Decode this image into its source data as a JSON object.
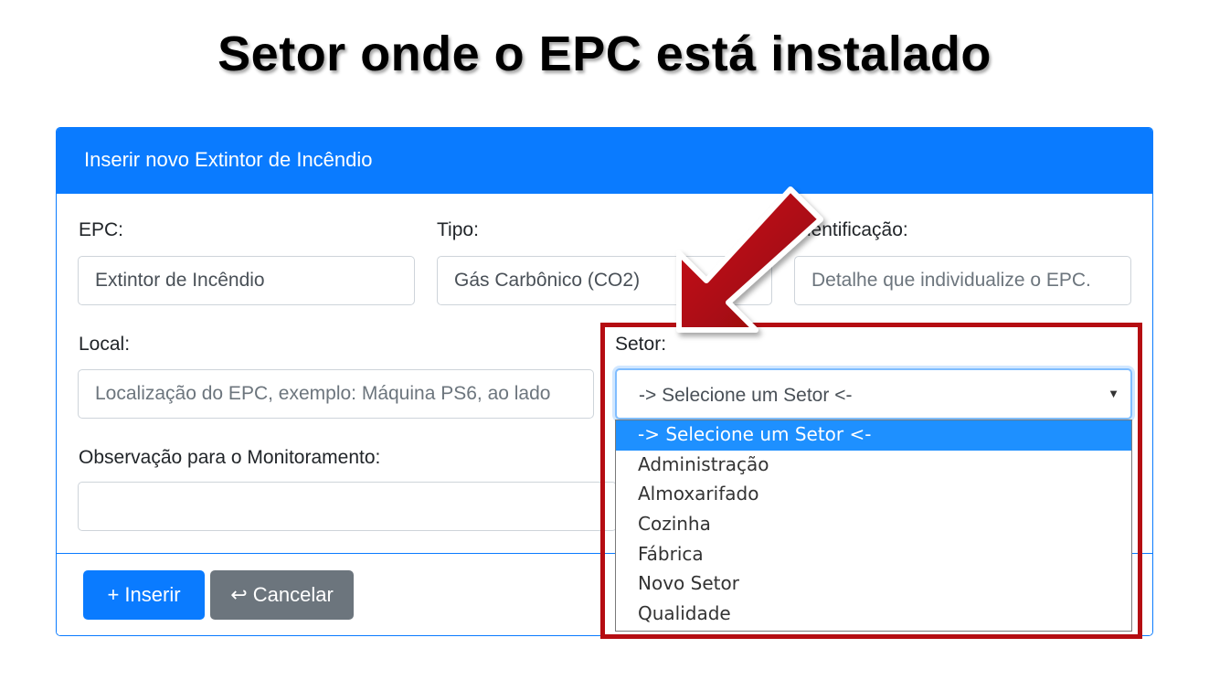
{
  "slide_title": "Setor onde o EPC está instalado",
  "card": {
    "header": "Inserir novo Extintor de Incêndio"
  },
  "form": {
    "epc": {
      "label": "EPC:",
      "value": "Extintor de Incêndio"
    },
    "tipo": {
      "label": "Tipo:",
      "value": "Gás Carbônico (CO2)"
    },
    "identificacao": {
      "label": "Identificação:",
      "placeholder": "Detalhe que individualize o EPC."
    },
    "local": {
      "label": "Local:",
      "placeholder": "Localização do EPC, exemplo: Máquina PS6, ao lado"
    },
    "setor": {
      "label": "Setor:",
      "selected": "-> Selecione um Setor <-",
      "options": [
        "-> Selecione um Setor <-",
        "Administração",
        "Almoxarifado",
        "Cozinha",
        "Fábrica",
        "Novo Setor",
        "Qualidade"
      ]
    },
    "observacao": {
      "label": "Observação para o Monitoramento:",
      "value": ""
    }
  },
  "footer": {
    "insert_label": "+ Inserir",
    "cancel_label": "↩ Cancelar"
  },
  "annotation": {
    "arrow_icon": "red-arrow-icon",
    "color": "#b50d12"
  },
  "colors": {
    "primary": "#0a7bff",
    "secondary": "#6c757d",
    "option_highlight": "#1e90ff"
  }
}
